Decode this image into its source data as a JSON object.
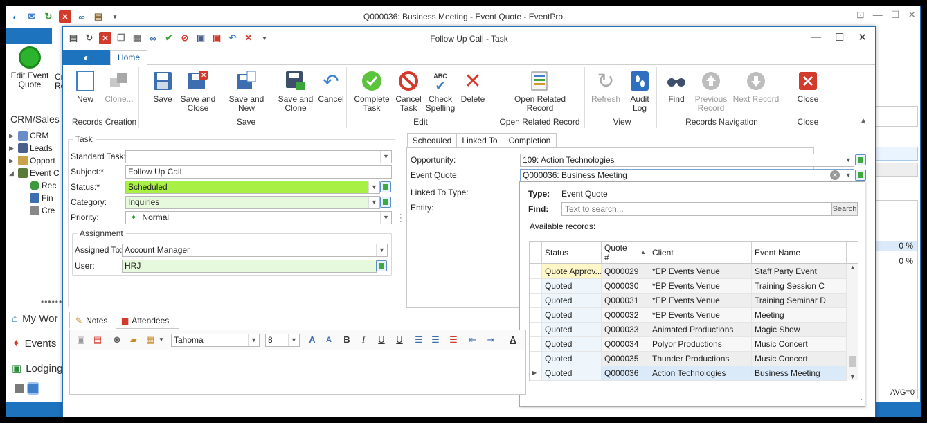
{
  "bg_window": {
    "title": "Q000036: Business Meeting - Event Quote - EventPro",
    "ribbon": {
      "edit_event_quote": "Edit Event Quote",
      "cut_label_1": "Cr",
      "cut_label_2": "Re"
    },
    "nav_title": "CRM/Sales",
    "nav_items": [
      "CRM",
      "Leads",
      "Opport",
      "Event C",
      "Rec",
      "Fin",
      "Cre"
    ],
    "nav_groups": [
      "My Wor",
      "Events",
      "Lodging"
    ],
    "right_values": [
      "0 %",
      "0 %"
    ],
    "avg": "AVG=0"
  },
  "task_window": {
    "title": "Follow Up Call - Task",
    "tabs": {
      "home": "Home"
    },
    "ribbon": {
      "groups": [
        "Records Creation",
        "Save",
        "Edit",
        "Open Related Record",
        "View",
        "Records Navigation",
        "Close"
      ],
      "new": "New",
      "clone": "Clone...",
      "save": "Save",
      "save_and_close": "Save and Close",
      "save_and_new": "Save and New",
      "save_and_clone": "Save and Clone",
      "cancel": "Cancel",
      "complete_task": "Complete Task",
      "cancel_task": "Cancel Task",
      "check_spelling": "Check Spelling",
      "abc": "ABC",
      "delete": "Delete",
      "open_related_record": "Open Related Record",
      "refresh": "Refresh",
      "audit_log": "Audit Log",
      "find": "Find",
      "previous_record": "Previous Record",
      "next_record": "Next Record",
      "close": "Close"
    },
    "task": {
      "legend": "Task",
      "standard_task_label": "Standard Task:",
      "standard_task_value": "",
      "subject_label": "Subject:*",
      "subject_value": "Follow Up Call",
      "status_label": "Status:*",
      "status_value": "Scheduled",
      "category_label": "Category:",
      "category_value": "Inquiries",
      "priority_label": "Priority:",
      "priority_value": "Normal",
      "assignment_legend": "Assignment",
      "assigned_to_label": "Assigned To:",
      "assigned_to_value": "Account Manager",
      "user_label": "User:",
      "user_value": "HRJ"
    },
    "linked": {
      "tabs": [
        "Scheduled",
        "Linked To",
        "Completion"
      ],
      "opportunity_label": "Opportunity:",
      "opportunity_value": "109: Action Technologies",
      "event_quote_label": "Event Quote:",
      "event_quote_value": "Q000036: Business Meeting",
      "linked_to_type_label": "Linked To Type:",
      "entity_label": "Entity:"
    },
    "popup": {
      "type_label": "Type:",
      "type_value": "Event Quote",
      "find_label": "Find:",
      "search_placeholder": "Text to search...",
      "search_button": "Search",
      "available_records": "Available records:",
      "columns": [
        "Status",
        "Quote #",
        "Client",
        "Event Name"
      ],
      "rows": [
        [
          "Quote Approv...",
          "Q000029",
          "*EP Events Venue",
          "Staff Party Event"
        ],
        [
          "Quoted",
          "Q000030",
          "*EP Events Venue",
          "Training Session C"
        ],
        [
          "Quoted",
          "Q000031",
          "*EP Events Venue",
          "Training Seminar D"
        ],
        [
          "Quoted",
          "Q000032",
          "*EP Events Venue",
          "Meeting"
        ],
        [
          "Quoted",
          "Q000033",
          "Animated Productions",
          "Magic Show"
        ],
        [
          "Quoted",
          "Q000034",
          "Polyor Productions",
          "Music Concert"
        ],
        [
          "Quoted",
          "Q000035",
          "Thunder Productions",
          "Music Concert"
        ],
        [
          "Quoted",
          "Q000036",
          "Action Technologies",
          "Business Meeting"
        ]
      ]
    },
    "notes": {
      "tabs": [
        "Notes",
        "Attendees"
      ],
      "font_name": "Tahoma",
      "font_size": "8"
    }
  },
  "colors": {
    "accent": "#1e73be",
    "status_green": "#a8f044",
    "light_green": "#e6f9dc"
  }
}
